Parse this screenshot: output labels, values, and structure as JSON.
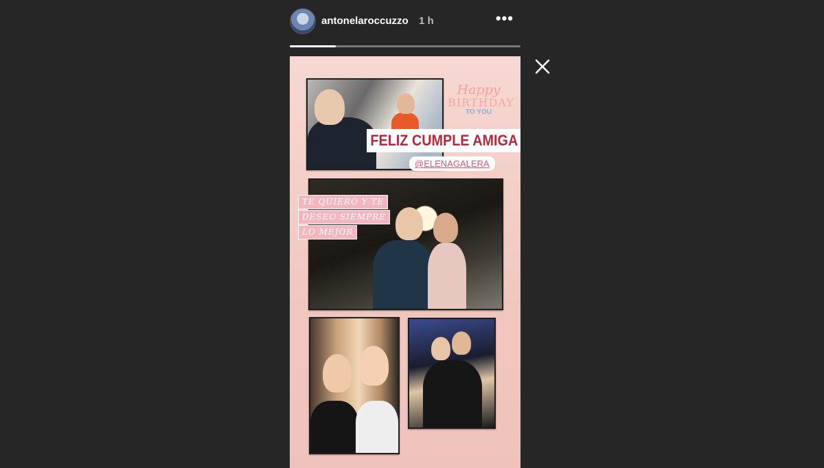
{
  "header": {
    "username": "antonelaroccuzzo",
    "time": "1 h",
    "more_icon": "more-horizontal-icon",
    "progress": 0.2
  },
  "close_icon": "close-icon",
  "story": {
    "sticker": {
      "line1": "Happy",
      "line2": "BIRTHDAY",
      "line3": "TO YOU"
    },
    "headline": "FELIZ CUMPLE AMIGA",
    "mention": "@ELENAGALERA",
    "quote_lines": [
      "TE QUIERO Y TE",
      "DESEO SIEMPRE",
      "LO MEJOR"
    ]
  }
}
